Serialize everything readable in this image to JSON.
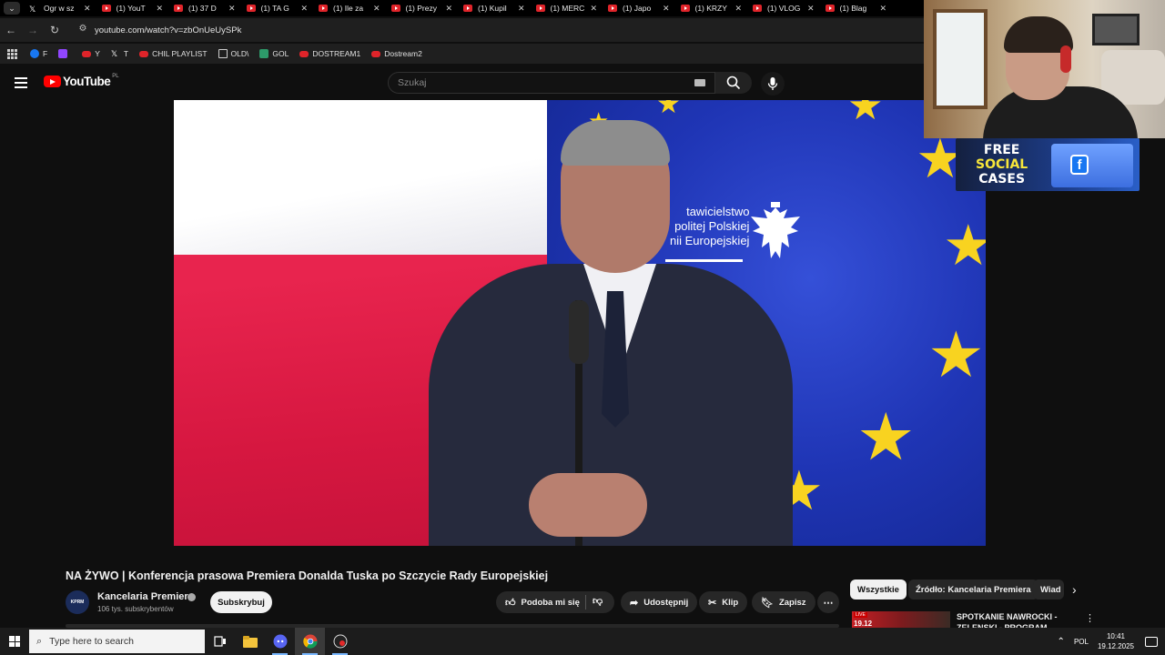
{
  "browser": {
    "tabs": [
      {
        "label": "Ogr w sz",
        "icon": "x-icon"
      },
      {
        "label": "(1) YouT",
        "icon": "youtube-icon"
      },
      {
        "label": "(1) 37 D",
        "icon": "youtube-icon"
      },
      {
        "label": "(1) TA G",
        "icon": "youtube-icon"
      },
      {
        "label": "(1) Ile za",
        "icon": "youtube-icon"
      },
      {
        "label": "(1) Prezy",
        "icon": "youtube-icon"
      },
      {
        "label": "(1) Kupil",
        "icon": "youtube-icon"
      },
      {
        "label": "(1) MERC",
        "icon": "youtube-icon"
      },
      {
        "label": "(1) Japo",
        "icon": "youtube-icon"
      },
      {
        "label": "(1) KRZY",
        "icon": "youtube-icon"
      },
      {
        "label": "(1) VLOG",
        "icon": "youtube-icon"
      },
      {
        "label": "(1) Blag",
        "icon": "youtube-icon"
      }
    ],
    "tab_close": "✕",
    "url": "youtube.com/watch?v=zbOnUeUySPk",
    "bookmarks": [
      {
        "label": "F",
        "icon": "facebook"
      },
      {
        "label": "",
        "icon": "twitch"
      },
      {
        "label": "Y",
        "icon": "youtube"
      },
      {
        "label": "T",
        "icon": "x"
      },
      {
        "label": "CHIL PLAYLIST",
        "icon": "youtube"
      },
      {
        "label": "OLD\\",
        "icon": "folder"
      },
      {
        "label": "GOL",
        "icon": "g"
      },
      {
        "label": "DOSTREAM1",
        "icon": "youtube"
      },
      {
        "label": "Dostream2",
        "icon": "youtube"
      }
    ]
  },
  "youtube": {
    "logo_text": "YouTube",
    "country_code": "PL",
    "search_placeholder": "Szukaj",
    "video": {
      "overlay_text_line1": "tawicielstwo",
      "overlay_text_line2": "politej Polskiej",
      "overlay_text_line3": "nii Europejskiej"
    },
    "title": "NA ŻYWO | Konferencja prasowa Premiera Donalda Tuska po Szczycie Rady Europejskiej",
    "channel": {
      "name": "Kancelaria Premiera",
      "subscribers": "106 tys. subskrybentów",
      "avatar_text": "KPRM",
      "subscribe_label": "Subskrybuj"
    },
    "actions": {
      "like_label": "Podoba mi się",
      "share_label": "Udostępnij",
      "clip_label": "Klip",
      "save_label": "Zapisz",
      "more": "⋯"
    },
    "chips": [
      {
        "label": "Wszystkie",
        "active": true
      },
      {
        "label": "Źródło: Kancelaria Premiera",
        "active": false
      },
      {
        "label": "Wiad",
        "active": false
      }
    ],
    "recommended": {
      "live_badge": "LIVE",
      "time": "19.12",
      "title": "SPOTKANIE NAWROCKI - ZELENSKI - PROGRAM"
    }
  },
  "overlay": {
    "promo_line1": "FREE",
    "promo_line2": "SOCIAL",
    "promo_line3": "CASES",
    "promo_icon": "f"
  },
  "taskbar": {
    "search_placeholder": "Type here to search",
    "language": "POL",
    "time": "10:41",
    "date": "19.12.2025"
  }
}
